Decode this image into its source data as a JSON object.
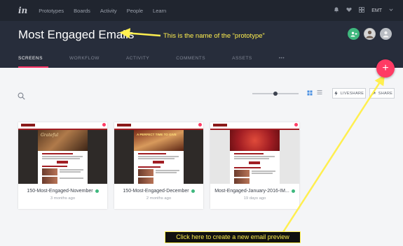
{
  "nav": {
    "logo": "in",
    "links": [
      "Prototypes",
      "Boards",
      "Activity",
      "People",
      "Learn"
    ],
    "user_initials": "EMT"
  },
  "header": {
    "title": "Most Engaged Emails",
    "annotation": "This is the name of the “prototype”",
    "tabs": [
      "SCREENS",
      "WORKFLOW",
      "ACTIVITY",
      "COMMENTS",
      "ASSETS",
      "•••"
    ],
    "active_tab": "SCREENS"
  },
  "toolbar": {
    "liveshare_label": "LIVESHARE",
    "share_label": "SHARE",
    "zoom_level": 0.5
  },
  "fab": {
    "label": "+"
  },
  "screens": [
    {
      "name": "150-Most-Engaged-November",
      "date": "3 months ago",
      "hero_text": "Grateful"
    },
    {
      "name": "150-Most-Engaged-December",
      "date": "2 months ago",
      "hero_text": "A PERFECT TIME TO GIVE"
    },
    {
      "name": "Most-Engaged-January-2016-IM...",
      "date": "19 days ago",
      "hero_text": ""
    }
  ],
  "callout_bottom": "Click here to create a new email preview",
  "colors": {
    "accent": "#ff3b64",
    "callout": "#ffef4f",
    "status": "#3fb87e"
  }
}
